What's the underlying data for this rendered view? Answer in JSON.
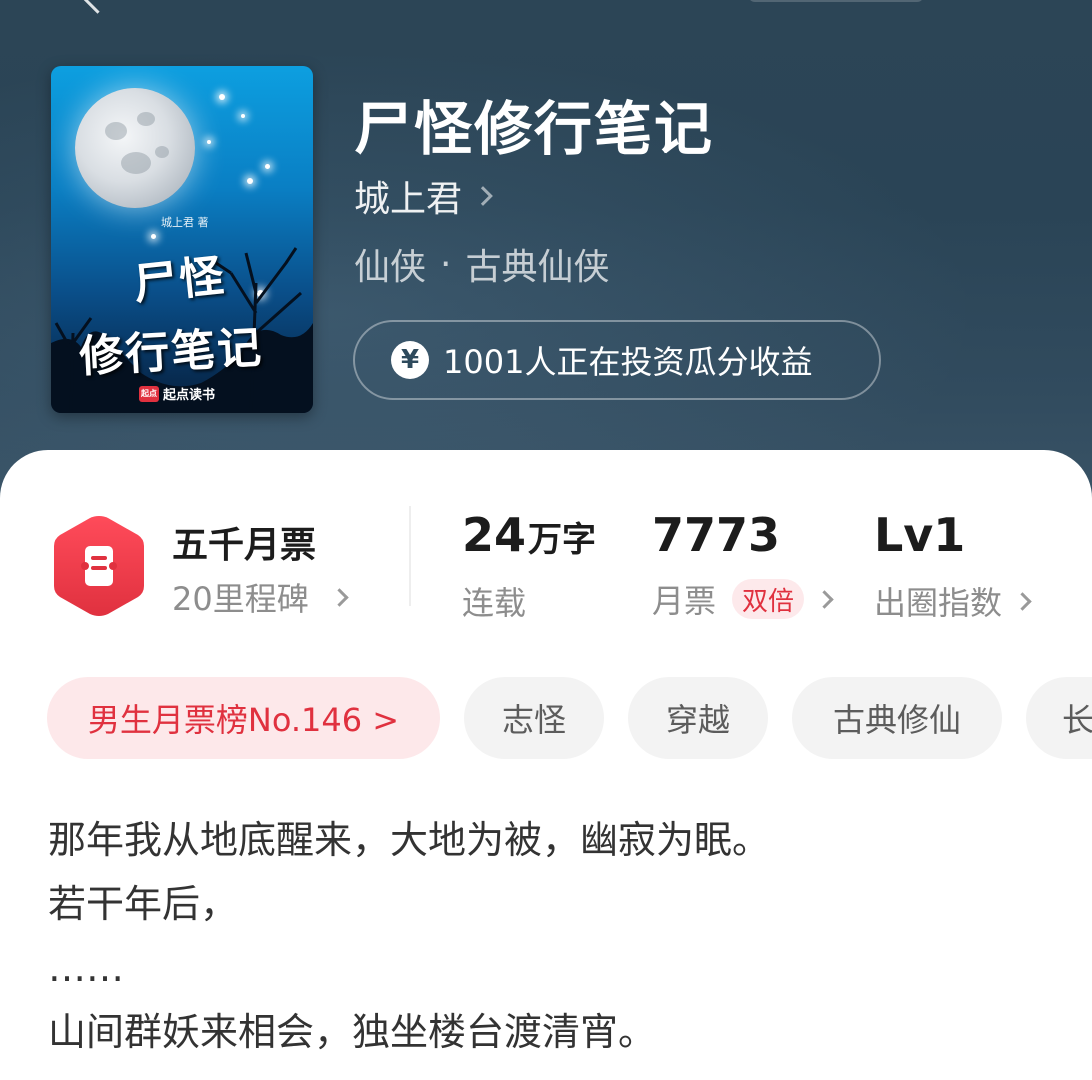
{
  "book": {
    "title": "尸怪修行笔记",
    "author": "城上君",
    "genre": "仙侠",
    "subgenre": "古典仙侠",
    "genre_separator": "·",
    "invest_text": "1001人正在投资瓜分收益",
    "invest_icon": "yen-icon"
  },
  "cover": {
    "author_credit": "城上君 著",
    "title_line1": "尸怪",
    "title_line2": "修行笔记",
    "publisher": "起点读书",
    "publisher_mark": "起点"
  },
  "stats": {
    "monthly_ticket_title": "五千月票",
    "milestone": "20里程碑",
    "word_count_num": "24",
    "word_count_unit": "万字",
    "status": "连载",
    "tickets": "7773",
    "tickets_label": "月票",
    "double_badge": "双倍",
    "level": "Lv1",
    "level_label": "出圈指数"
  },
  "tags": {
    "rank": "男生月票榜No.146 >",
    "items": [
      "志怪",
      "穿越",
      "古典修仙",
      "长"
    ]
  },
  "synopsis": {
    "lines": [
      "那年我从地底醒来，大地为被，幽寂为眠。",
      "若干年后，",
      "……",
      "山间群妖来相会，独坐楼台渡清宵。"
    ]
  },
  "colors": {
    "header_bg": "#2c4556",
    "accent_red": "#e0313f",
    "tag_bg": "#f3f3f3",
    "rank_tag_bg": "#fde8ea"
  }
}
